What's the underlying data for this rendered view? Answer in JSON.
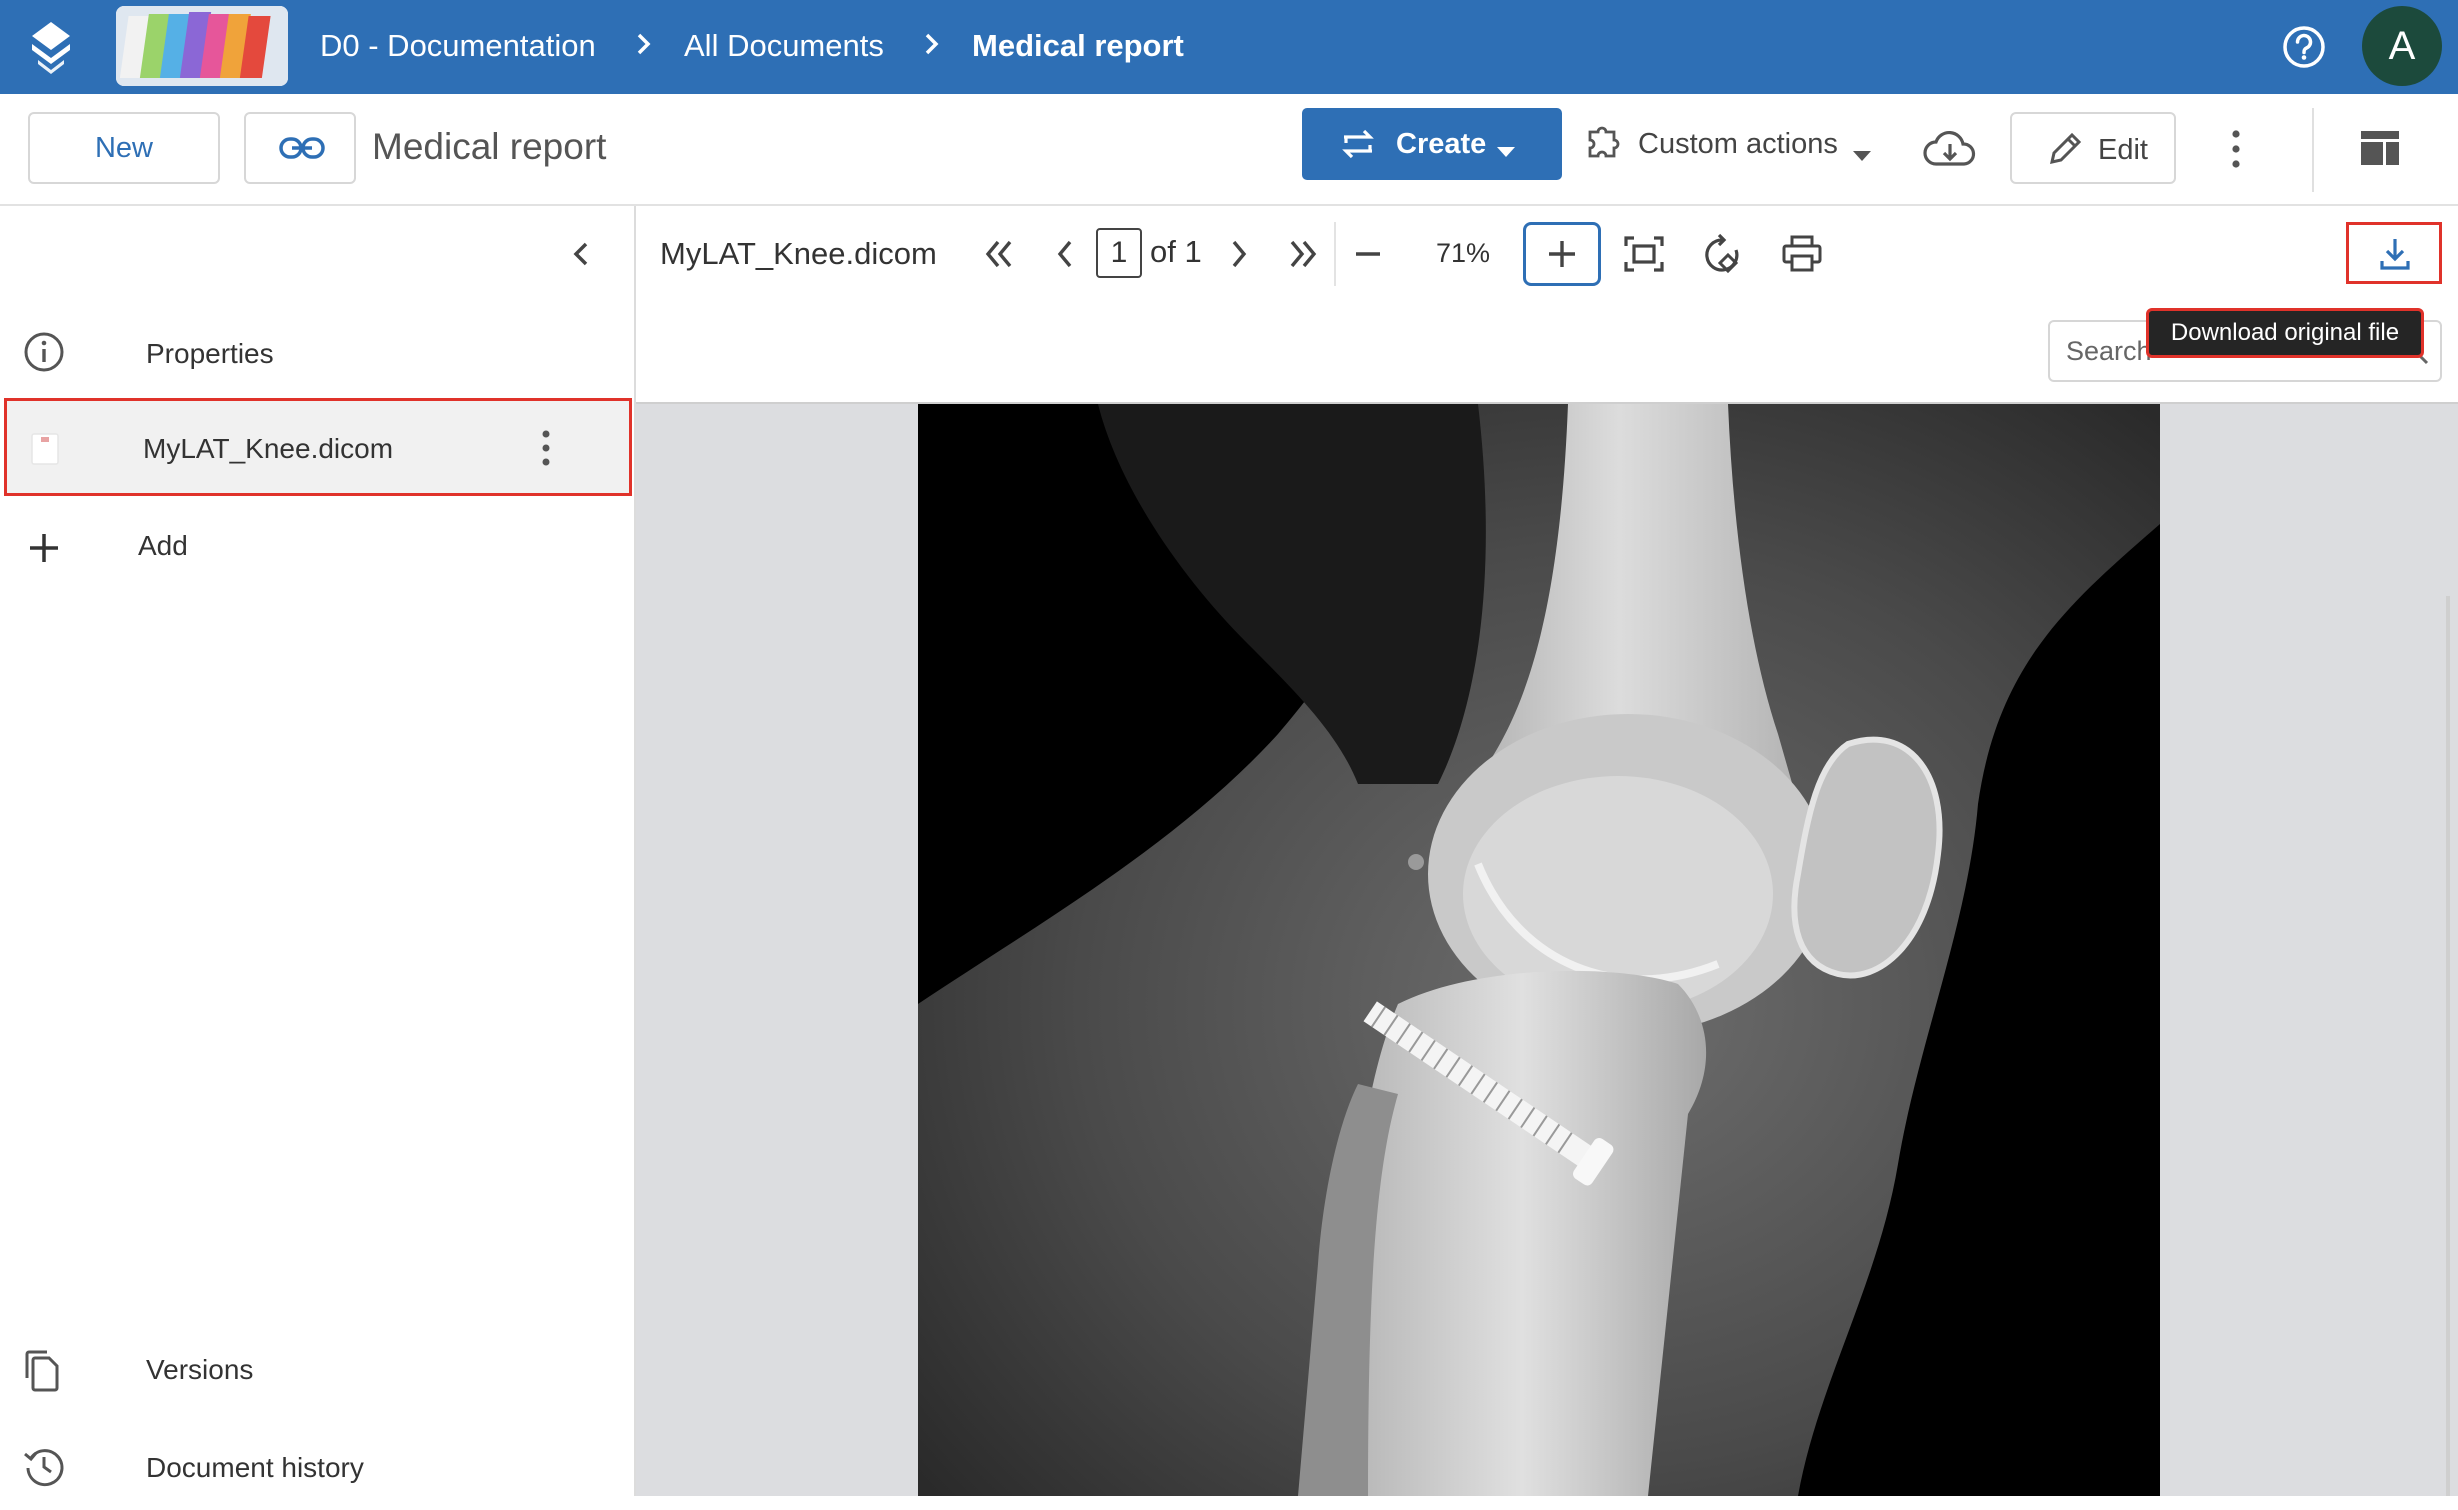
{
  "header": {
    "breadcrumb": [
      "D0 - Documentation",
      "All Documents",
      "Medical report"
    ],
    "avatar_letter": "A"
  },
  "toolbar": {
    "new_label": "New",
    "document_title": "Medical report",
    "create_label": "Create",
    "custom_actions_label": "Custom actions",
    "edit_label": "Edit"
  },
  "sidebar": {
    "properties_label": "Properties",
    "file_name": "MyLAT_Knee.dicom",
    "add_label": "Add",
    "versions_label": "Versions",
    "history_label": "Document history"
  },
  "viewer": {
    "file_name": "MyLAT_Knee.dicom",
    "page_current": "1",
    "page_of": "of 1",
    "zoom": "71%",
    "search_placeholder": "Search",
    "download_tooltip": "Download original file"
  },
  "colors": {
    "brand_blue": "#2e6fb5",
    "highlight_red": "#e0322a",
    "avatar_bg": "#1c4a3c"
  }
}
